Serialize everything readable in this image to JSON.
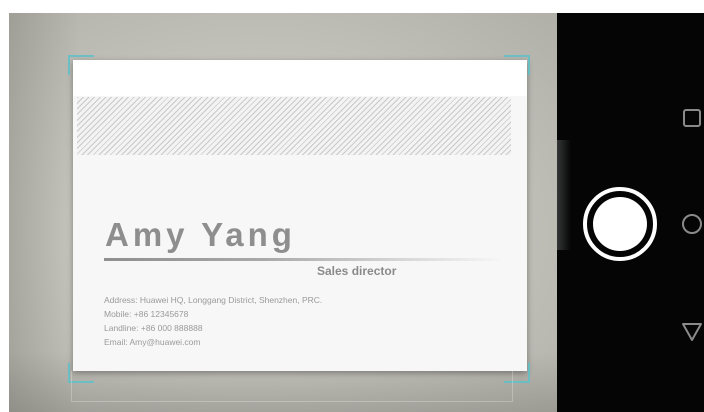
{
  "card": {
    "name": "Amy Yang",
    "title": "Sales director",
    "address": "Address: Huawei HQ, Longgang District, Shenzhen, PRC.",
    "mobile": "Mobile: +86 12345678",
    "landline": "Landline: +86 000 888888",
    "email": "Email: Amy@huawei.com"
  },
  "icons": {
    "shutter": "shutter-button-icon",
    "recent": "recent-apps-square-icon",
    "home": "home-circle-icon",
    "back": "back-triangle-icon"
  },
  "colors": {
    "scan_frame": "#5fc1c8",
    "control_panel": "#050505",
    "card_text": "#8e8e8e"
  }
}
